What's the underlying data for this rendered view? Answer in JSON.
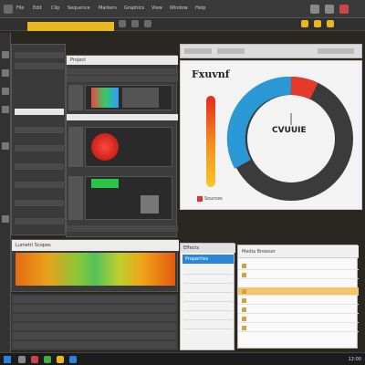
{
  "topbar": {
    "texts": [
      "File",
      "Edit",
      "Clip",
      "Sequence",
      "Markers",
      "Graphics",
      "View",
      "Window",
      "Help"
    ]
  },
  "accent_color": "#e8b820",
  "center": {
    "header": "Project"
  },
  "chart_card": {
    "title": "Fxuvnf",
    "donut_label": "CVUUIE",
    "legend": "Sources"
  },
  "strip": {
    "header": "Lumetri Scopes"
  },
  "props": {
    "header": "Effects",
    "selected": "Properties"
  },
  "list": {
    "header": "Media Browser"
  },
  "taskbar": {
    "time": "12:00"
  }
}
